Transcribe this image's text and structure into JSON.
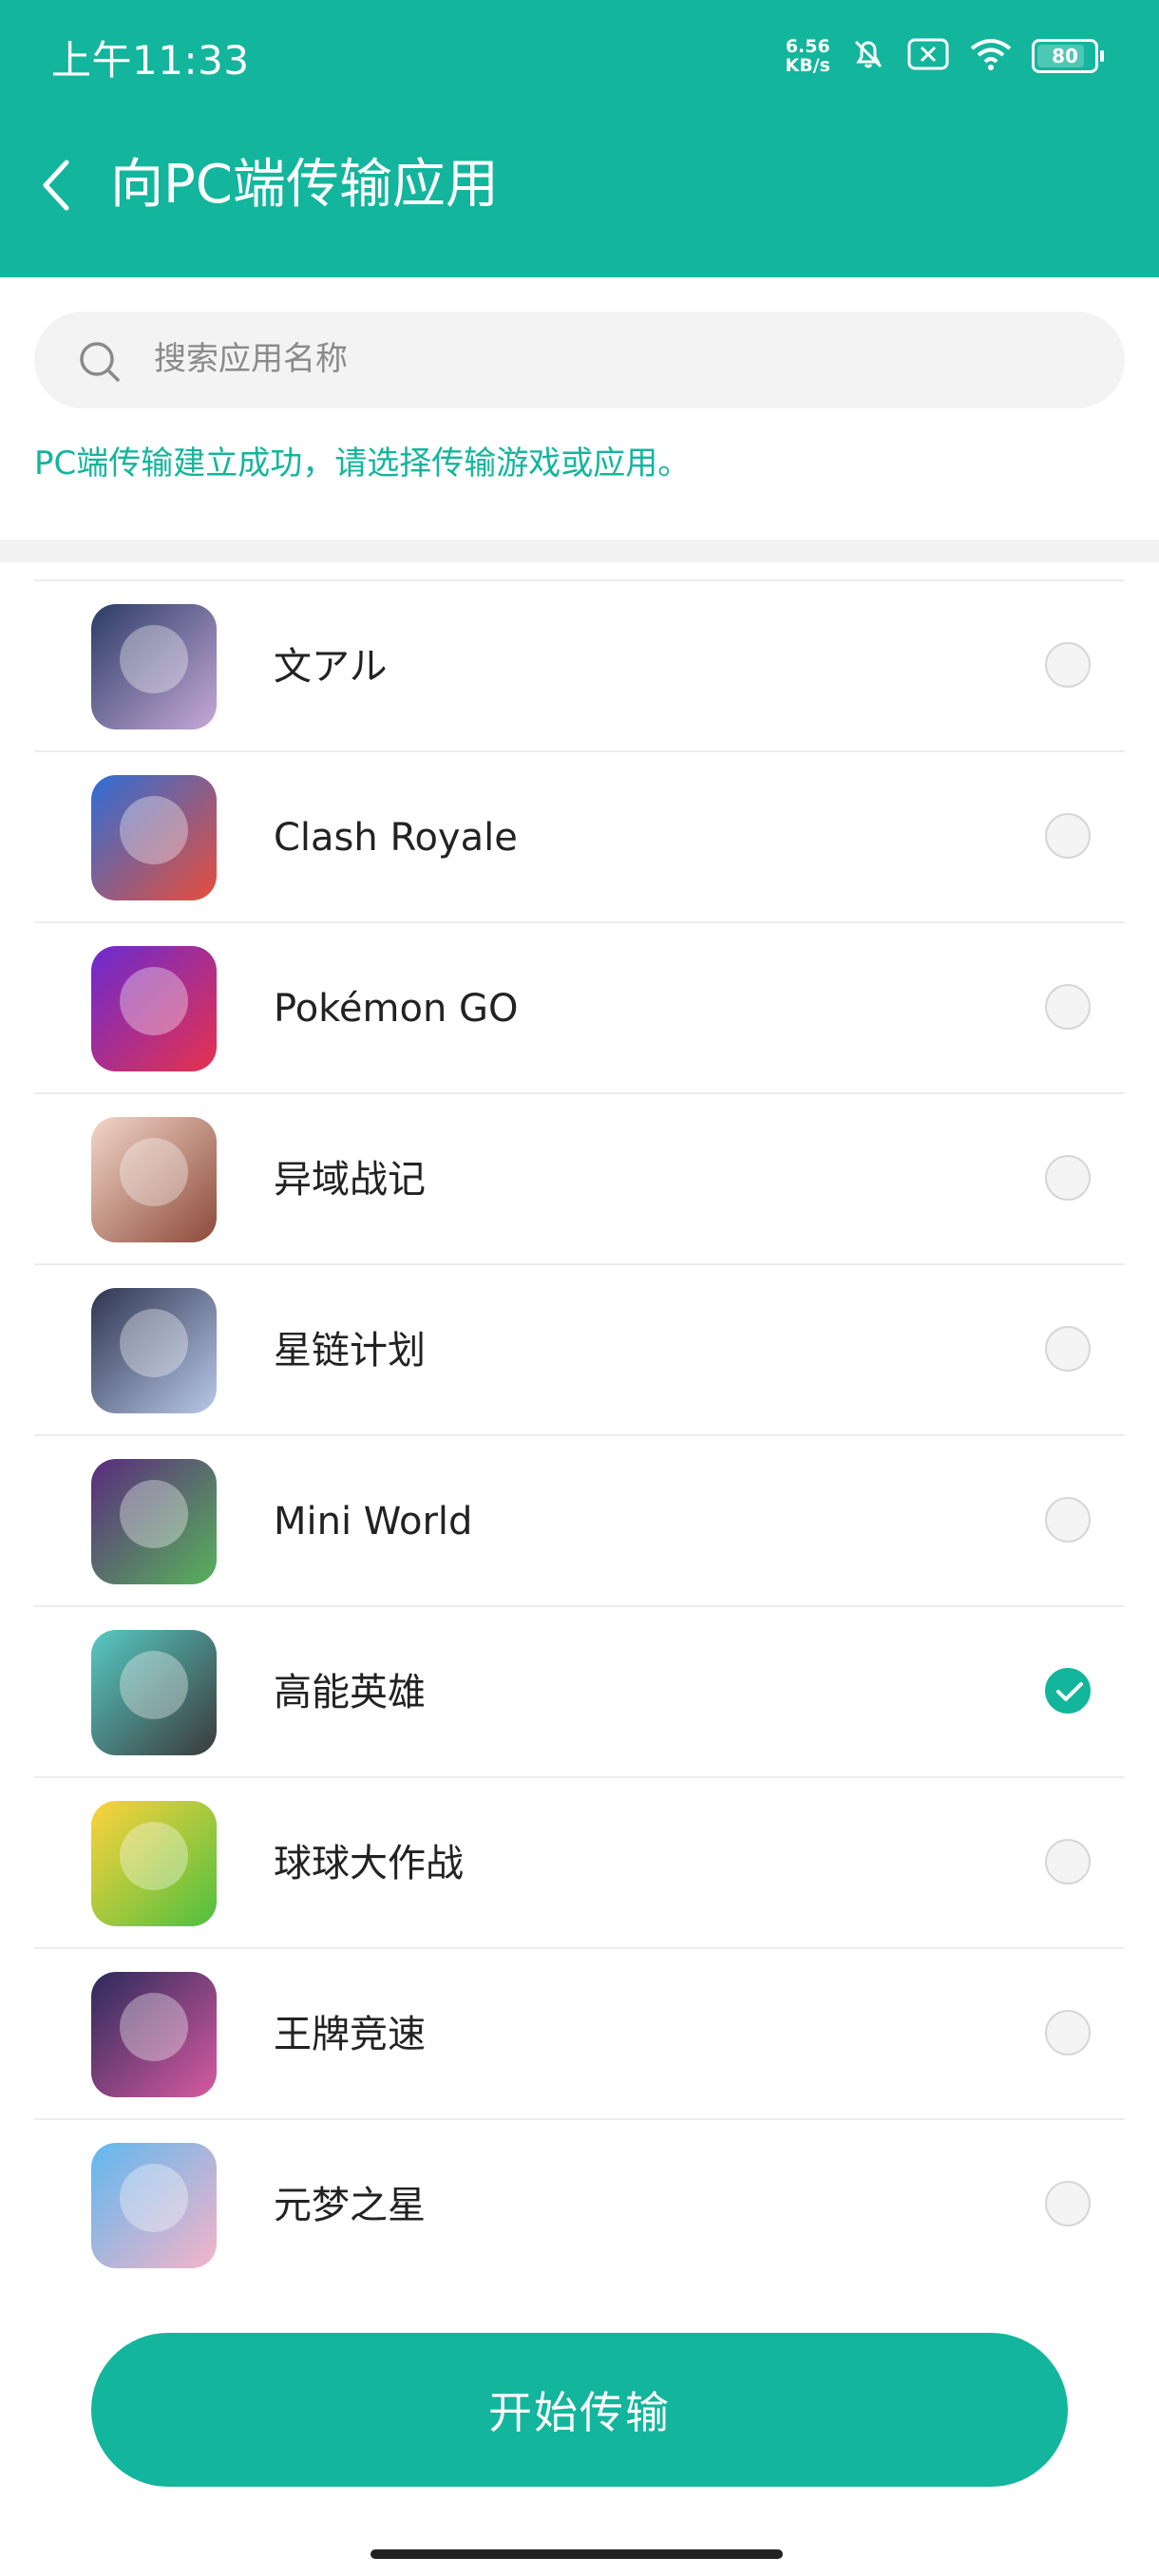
{
  "status_bar": {
    "time": "上午11:33",
    "speed_value": "6.56",
    "speed_unit": "KB/s",
    "battery": "80"
  },
  "header": {
    "title": "向PC端传输应用"
  },
  "search": {
    "placeholder": "搜索应用名称"
  },
  "info_text": "PC端传输建立成功，请选择传输游戏或应用。",
  "apps": [
    {
      "name": "",
      "icon": "partial-app-icon",
      "colors": [
        "#f0a080",
        "#e8542f"
      ],
      "checked": false
    },
    {
      "name": "文アル",
      "icon": "bungo-alchemist-icon",
      "colors": [
        "#2b3c66",
        "#c6a9d8"
      ],
      "checked": false
    },
    {
      "name": "Clash Royale",
      "icon": "clash-royale-icon",
      "colors": [
        "#2c6fd8",
        "#e84d3b"
      ],
      "checked": false
    },
    {
      "name": "Pokémon GO",
      "icon": "pokemon-go-icon",
      "colors": [
        "#6a2bd0",
        "#e8314d"
      ],
      "checked": false
    },
    {
      "name": "异域战记",
      "icon": "yiyu-zhanji-icon",
      "colors": [
        "#f2d6c8",
        "#8c4a3a"
      ],
      "checked": false
    },
    {
      "name": "星链计划",
      "icon": "xinglian-jihua-icon",
      "colors": [
        "#2e3550",
        "#b9c8e8"
      ],
      "checked": false
    },
    {
      "name": "Mini World",
      "icon": "mini-world-icon",
      "colors": [
        "#5b2a7e",
        "#57b35b"
      ],
      "checked": false
    },
    {
      "name": "高能英雄",
      "icon": "gaoneng-yingxiong-icon",
      "colors": [
        "#58c9c4",
        "#3a3a3a"
      ],
      "checked": true
    },
    {
      "name": "球球大作战",
      "icon": "qiuqiu-dazuozhan-icon",
      "colors": [
        "#ffd23c",
        "#4fbf3f"
      ],
      "checked": false
    },
    {
      "name": "王牌竞速",
      "icon": "wangpai-jingsu-icon",
      "colors": [
        "#2a2a5a",
        "#d85aa0"
      ],
      "checked": false
    },
    {
      "name": "元梦之星",
      "icon": "yuanmeng-zhixing-icon",
      "colors": [
        "#5fb8f0",
        "#f6b3c8"
      ],
      "checked": false
    }
  ],
  "button": {
    "start_label": "开始传输"
  },
  "colors": {
    "accent": "#13b59c"
  }
}
